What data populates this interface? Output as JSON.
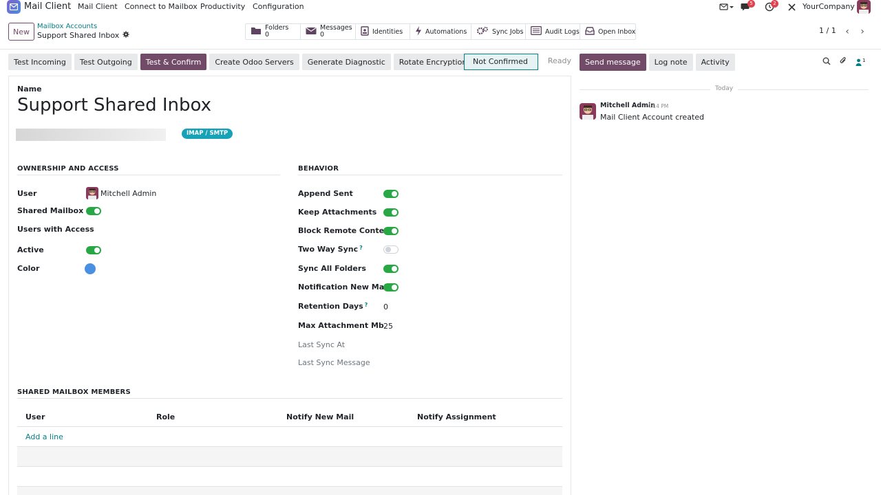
{
  "app": {
    "title": "Mail Client",
    "brand_color": "#714b67",
    "accent_color": "#017e84"
  },
  "navbar": {
    "menu": [
      "Mail Client",
      "Connect to Mailbox",
      "Productivity",
      "Configuration"
    ],
    "messages_badge": "5",
    "activities_badge": "2",
    "company": "YourCompany",
    "icons": [
      "mail-dropdown-icon",
      "chat-bubbles-icon",
      "clock-activity-icon",
      "debug-tools-icon"
    ]
  },
  "control_panel": {
    "new_label": "New",
    "breadcrumb_parent": "Mailbox Accounts",
    "breadcrumb_current": "Support Shared Inbox",
    "smart_buttons": [
      {
        "label": "Folders",
        "count": "0",
        "icon": "folder-icon"
      },
      {
        "label": "Messages",
        "count": "0",
        "icon": "envelope-icon"
      },
      {
        "label": "Identities",
        "icon": "id-card-icon"
      },
      {
        "label": "Automations",
        "icon": "bolt-icon"
      },
      {
        "label": "Sync Jobs",
        "icon": "gears-icon"
      },
      {
        "label": "Audit Logs",
        "icon": "list-log-icon"
      },
      {
        "label": "Open Inbox",
        "icon": "inbox-icon"
      }
    ],
    "pager": "1 / 1"
  },
  "actions": [
    "Test Incoming",
    "Test Outgoing",
    "Test & Confirm",
    "Create Odoo Servers",
    "Generate Diagnostic",
    "Rotate Encryption"
  ],
  "statusbar": {
    "active": "Not Confirmed",
    "next": "Ready"
  },
  "form": {
    "name_label": "Name",
    "name_value": "Support Shared Inbox",
    "tag": "IMAP / SMTP",
    "ownership": {
      "title": "OWNERSHIP AND ACCESS",
      "user_label": "User",
      "user_value": "Mitchell Admin",
      "shared_label": "Shared Mailbox",
      "shared": true,
      "users_access_label": "Users with Access",
      "active_label": "Active",
      "active": true,
      "color_label": "Color",
      "color_value": "#4a90e2"
    },
    "behavior": {
      "title": "BEHAVIOR",
      "append_sent_label": "Append Sent",
      "append_sent": true,
      "keep_attachments_label": "Keep Attachments",
      "keep_attachments": true,
      "block_remote_label": "Block Remote Content",
      "block_remote": true,
      "two_way_sync_label": "Two Way Sync",
      "two_way_sync": false,
      "sync_all_label": "Sync All Folders",
      "sync_all": true,
      "notification_label": "Notification New Mail",
      "notification": true,
      "retention_label": "Retention Days",
      "retention_value": "0",
      "max_attach_label": "Max Attachment Mb",
      "max_attach_value": "25",
      "last_sync_at_label": "Last Sync At",
      "last_sync_msg_label": "Last Sync Message"
    },
    "members": {
      "title": "SHARED MAILBOX MEMBERS",
      "columns": [
        "User",
        "Role",
        "Notify New Mail",
        "Notify Assignment"
      ],
      "add_line": "Add a line"
    }
  },
  "chatter": {
    "send_message": "Send message",
    "log_note": "Log note",
    "activity": "Activity",
    "followers_count": "1",
    "date_separator": "Today",
    "message": {
      "author": "Mitchell Admin",
      "time": "4:14 PM",
      "body": "Mail Client Account created"
    }
  }
}
